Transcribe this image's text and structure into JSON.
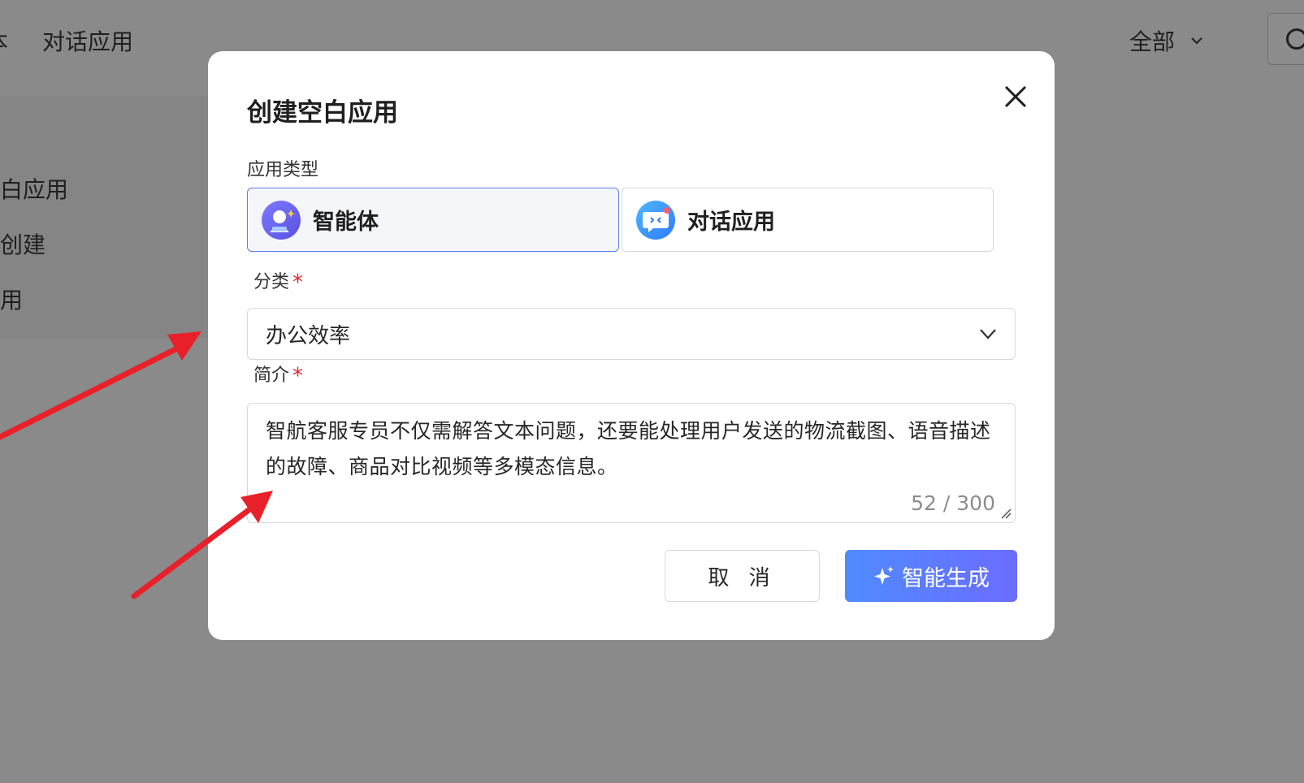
{
  "background": {
    "tabs": [
      {
        "label": "本"
      },
      {
        "label": "对话应用"
      }
    ],
    "filter": {
      "label": "全部"
    },
    "side_items": [
      {
        "label": "白应用"
      },
      {
        "label": "创建"
      },
      {
        "label": "用"
      }
    ]
  },
  "modal": {
    "title": "创建空白应用",
    "type_label": "应用类型",
    "types": [
      {
        "label": "智能体",
        "icon": "agent-avatar-icon",
        "selected": true
      },
      {
        "label": "对话应用",
        "icon": "chat-bubble-icon",
        "selected": false
      }
    ],
    "category": {
      "label": "分类",
      "required_mark": "*",
      "value": "办公效率"
    },
    "intro": {
      "label": "简介",
      "required_mark": "*",
      "value": "智航客服专员不仅需解答文本问题，还要能处理用户发送的物流截图、语音描述的故障、商品对比视频等多模态信息。",
      "counter": "52 / 300"
    },
    "buttons": {
      "cancel": "取 消",
      "generate": "智能生成"
    }
  },
  "colors": {
    "overlay": "#8a8a8a",
    "primary_gradient_start": "#4f8bff",
    "primary_gradient_end": "#6c6cff",
    "required": "#d9262f",
    "selected_border": "#5b7cf0",
    "arrow": "#e8202a"
  }
}
